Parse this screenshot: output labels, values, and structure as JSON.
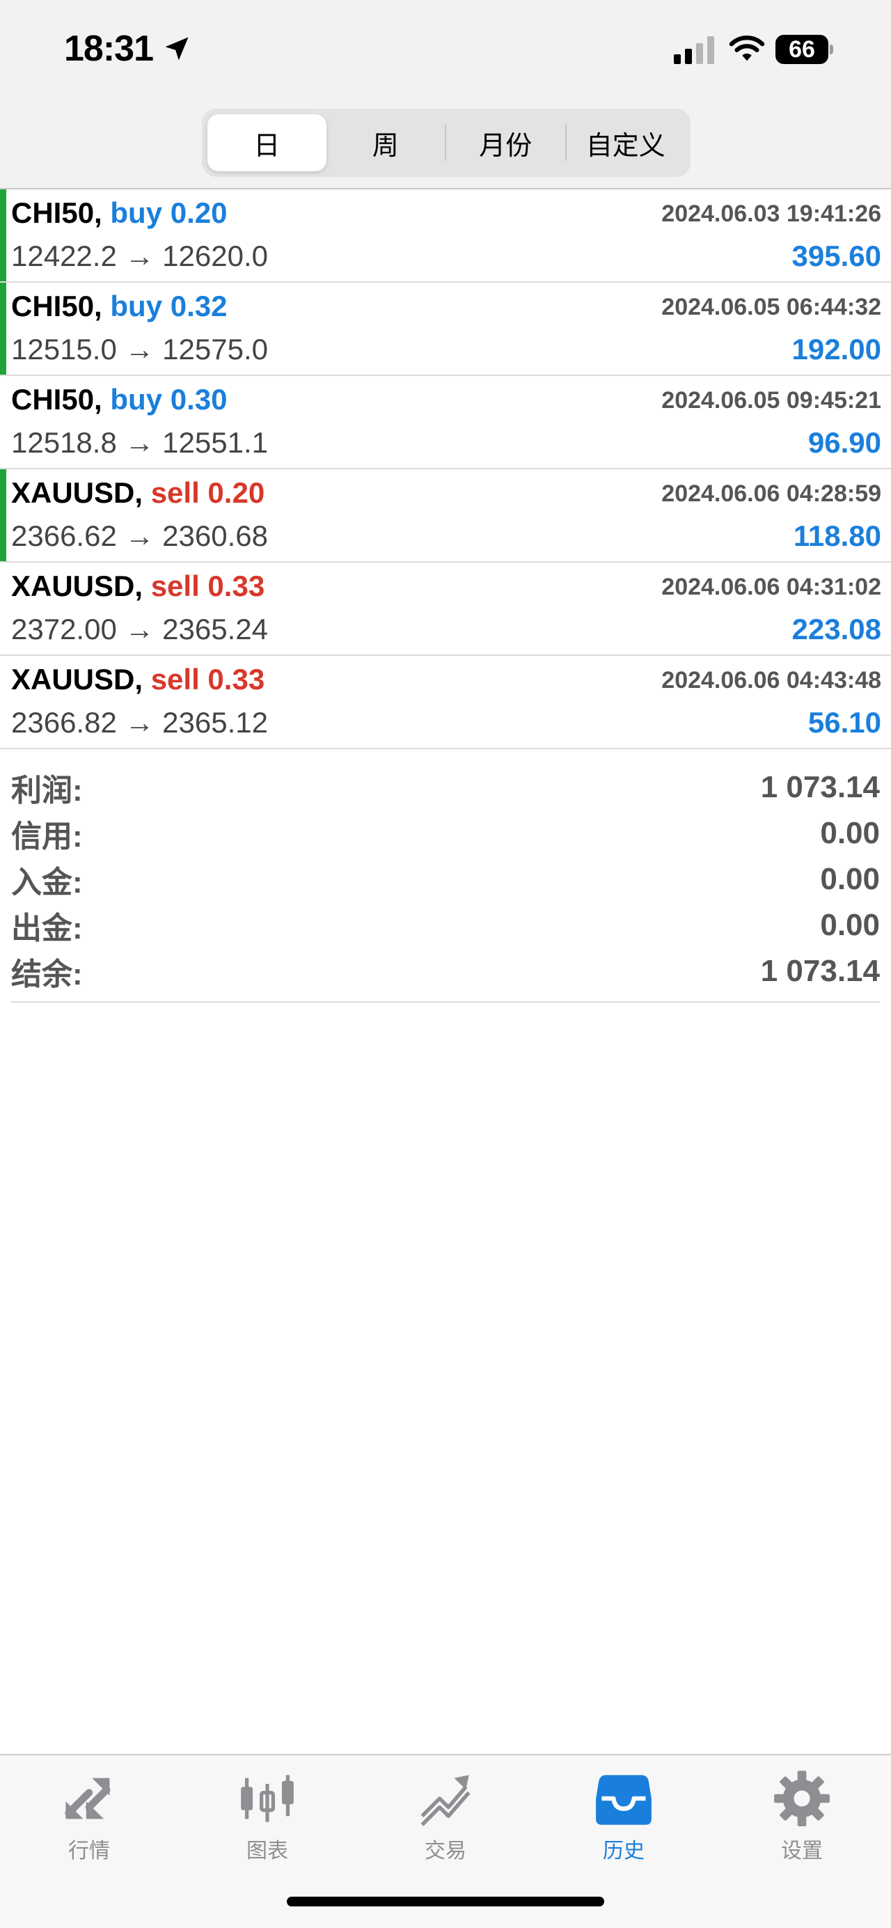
{
  "status_bar": {
    "time": "18:31",
    "battery": "66",
    "location_icon": "location-arrow-icon",
    "signal_icon": "cellular-signal-icon",
    "wifi_icon": "wifi-icon"
  },
  "segments": [
    {
      "label": "日",
      "active": true
    },
    {
      "label": "周",
      "active": false
    },
    {
      "label": "月份",
      "active": false
    },
    {
      "label": "自定义",
      "active": false
    }
  ],
  "trades": [
    {
      "symbol": "CHI50,",
      "side": "buy",
      "side_label": "buy 0.20",
      "time": "2024.06.03 19:41:26",
      "prices": "12422.2 → 12620.0",
      "profit": "395.60",
      "accent": true
    },
    {
      "symbol": "CHI50,",
      "side": "buy",
      "side_label": "buy 0.32",
      "time": "2024.06.05 06:44:32",
      "prices": "12515.0 → 12575.0",
      "profit": "192.00",
      "accent": true
    },
    {
      "symbol": "CHI50,",
      "side": "buy",
      "side_label": "buy 0.30",
      "time": "2024.06.05 09:45:21",
      "prices": "12518.8 → 12551.1",
      "profit": "96.90",
      "accent": false
    },
    {
      "symbol": "XAUUSD,",
      "side": "sell",
      "side_label": "sell 0.20",
      "time": "2024.06.06 04:28:59",
      "prices": "2366.62 → 2360.68",
      "profit": "118.80",
      "accent": true
    },
    {
      "symbol": "XAUUSD,",
      "side": "sell",
      "side_label": "sell 0.33",
      "time": "2024.06.06 04:31:02",
      "prices": "2372.00 → 2365.24",
      "profit": "223.08",
      "accent": false
    },
    {
      "symbol": "XAUUSD,",
      "side": "sell",
      "side_label": "sell 0.33",
      "time": "2024.06.06 04:43:48",
      "prices": "2366.82 → 2365.12",
      "profit": "56.10",
      "accent": false
    }
  ],
  "summary": [
    {
      "label": "利润:",
      "value": "1 073.14"
    },
    {
      "label": "信用:",
      "value": "0.00"
    },
    {
      "label": "入金:",
      "value": "0.00"
    },
    {
      "label": "出金:",
      "value": "0.00"
    },
    {
      "label": "结余:",
      "value": "1 073.14"
    }
  ],
  "tabs": [
    {
      "label": "行情",
      "icon": "quotes-icon",
      "active": false
    },
    {
      "label": "图表",
      "icon": "chart-icon",
      "active": false
    },
    {
      "label": "交易",
      "icon": "trade-icon",
      "active": false
    },
    {
      "label": "历史",
      "icon": "history-icon",
      "active": true
    },
    {
      "label": "设置",
      "icon": "settings-icon",
      "active": false
    }
  ],
  "colors": {
    "buy": "#1a7fdc",
    "sell": "#d8372b",
    "accent_green": "#21a335",
    "tab_active": "#1a7fdc",
    "tab_inactive": "#8e8e93"
  }
}
